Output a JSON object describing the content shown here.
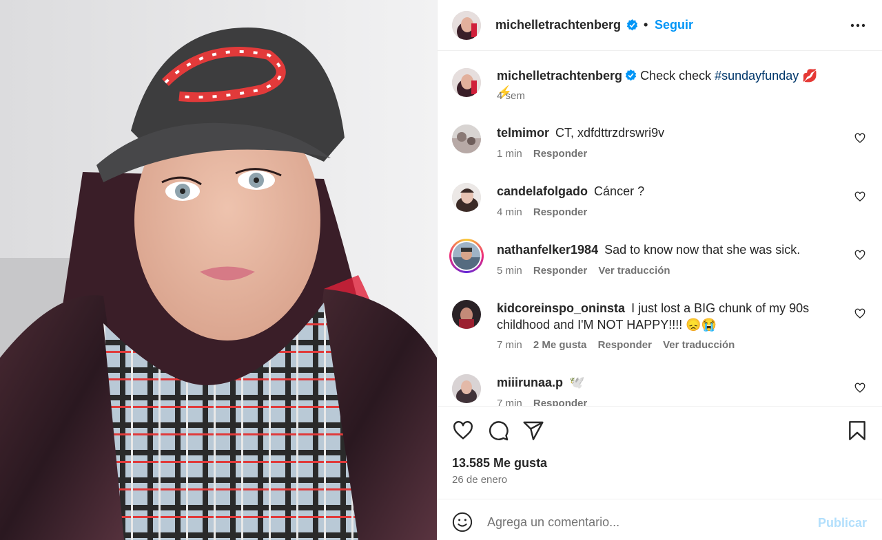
{
  "post": {
    "author": "michelletrachtenberg",
    "follow_label": "Seguir",
    "separator": "•",
    "caption_text": "Check check",
    "caption_hashtag": "#sundayfunday",
    "caption_emoji": "💋⚡",
    "caption_time": "4 sem"
  },
  "comments": [
    {
      "user": "telmimor",
      "text": "CT, xdfdttrzdrswri9v",
      "time": "1 min",
      "likes": "",
      "reply": "Responder",
      "translate": ""
    },
    {
      "user": "candelafolgado",
      "text": "Cáncer ?",
      "time": "4 min",
      "likes": "",
      "reply": "Responder",
      "translate": ""
    },
    {
      "user": "nathanfelker1984",
      "text": "Sad to know now that she was sick.",
      "time": "5 min",
      "likes": "",
      "reply": "Responder",
      "translate": "Ver traducción"
    },
    {
      "user": "kidcoreinspo_oninsta",
      "text": "I just lost a BIG chunk of my 90s childhood and I'M NOT HAPPY!!!! 😞😭",
      "time": "7 min",
      "likes": "2 Me gusta",
      "reply": "Responder",
      "translate": "Ver traducción"
    },
    {
      "user": "miiirunaa.p",
      "text": "🕊️",
      "time": "7 min",
      "likes": "",
      "reply": "Responder",
      "translate": ""
    }
  ],
  "stats": {
    "likes": "13.585 Me gusta",
    "date": "26 de enero"
  },
  "add_comment": {
    "placeholder": "Agrega un comentario...",
    "publish_label": "Publicar"
  },
  "colors": {
    "accent": "#0095f6",
    "hashtag": "#00376b",
    "muted": "#737373",
    "publish_disabled": "#b2dffc"
  }
}
